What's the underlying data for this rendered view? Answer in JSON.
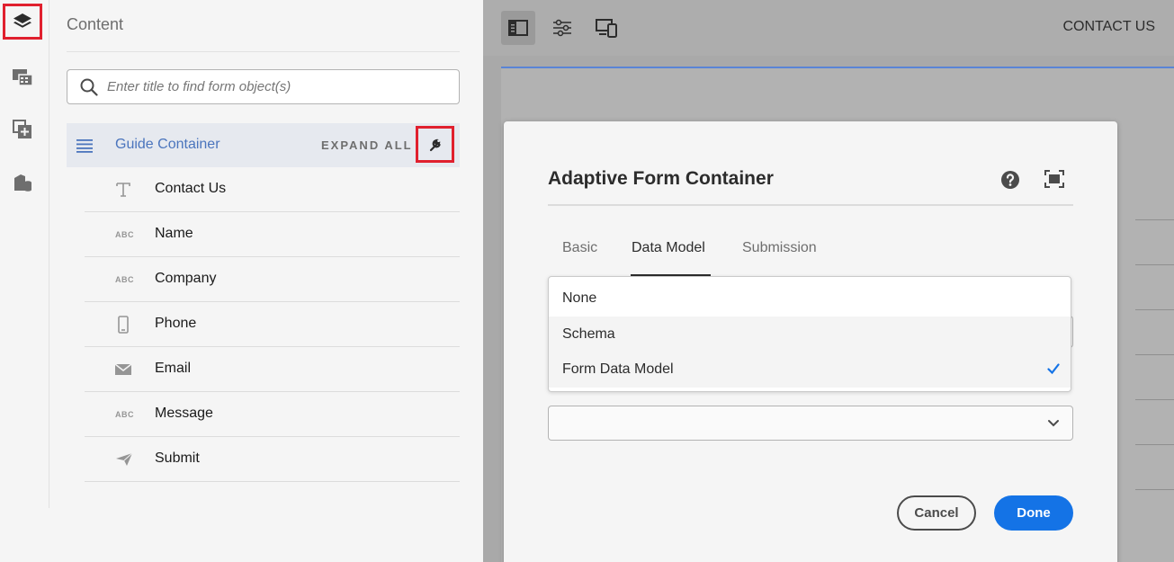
{
  "panel": {
    "title": "Content",
    "search_placeholder": "Enter title to find form object(s)",
    "guide_container": {
      "label": "Guide Container",
      "expand_all": "EXPAND ALL"
    },
    "items": [
      {
        "label": "Contact Us",
        "icon": "text-icon",
        "icon_text": ""
      },
      {
        "label": "Name",
        "icon": "abc-icon",
        "icon_text": "ABC"
      },
      {
        "label": "Company",
        "icon": "abc-icon",
        "icon_text": "ABC"
      },
      {
        "label": "Phone",
        "icon": "phone-icon",
        "icon_text": ""
      },
      {
        "label": "Email",
        "icon": "email-icon",
        "icon_text": ""
      },
      {
        "label": "Message",
        "icon": "abc-icon",
        "icon_text": "ABC"
      },
      {
        "label": "Submit",
        "icon": "send-icon",
        "icon_text": ""
      }
    ]
  },
  "rail": {
    "icons": [
      "layers-icon",
      "assets-icon",
      "add-component-icon",
      "data-sources-icon"
    ]
  },
  "toolbar": {
    "icons": [
      "side-panel-icon",
      "properties-icon",
      "emulator-icon"
    ],
    "page_title": "CONTACT US"
  },
  "dialog": {
    "title": "Adaptive Form Container",
    "tabs": [
      "Basic",
      "Data Model",
      "Submission"
    ],
    "selected_tab": "Data Model",
    "dropdown_options": [
      "None",
      "Schema",
      "Form Data Model"
    ],
    "selected_option": "Form Data Model",
    "cancel_label": "Cancel",
    "done_label": "Done"
  },
  "colors": {
    "accent": "#1473e6",
    "highlight_box": "#e0202e",
    "guide_text": "#4b75bd"
  }
}
